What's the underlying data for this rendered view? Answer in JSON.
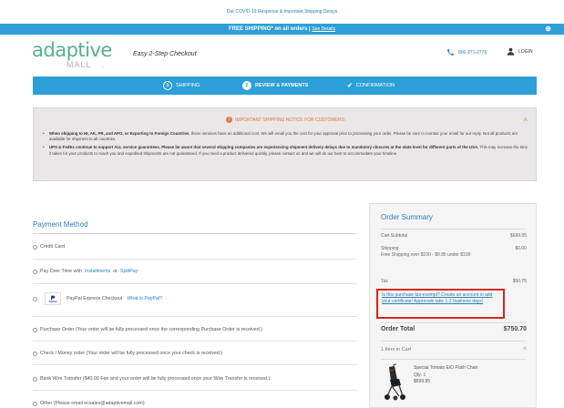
{
  "top_notice": "Our COVID-19 Response & Important Shipping Delays",
  "promo": {
    "text": "FREE SHIPPING* on all orders",
    "separator": "|",
    "details_link": "See Details",
    "expand_icon": "plus-circle-icon"
  },
  "header": {
    "logo_main": "adaptive",
    "logo_sub": "MALL",
    "logo_tm": "™",
    "tagline": "Easy 2-Step Checkout",
    "phone": "800-371-2778",
    "phone_icon": "phone-icon",
    "login": "LOGIN",
    "login_icon": "user-icon"
  },
  "steps": [
    {
      "number": "1",
      "label": "SHIPPING"
    },
    {
      "number": "2",
      "label": "REVIEW & PAYMENTS"
    },
    {
      "check": "✔",
      "label": "CONFIRMATION"
    }
  ],
  "notice": {
    "title": "IMPORTANT SHIPPING NOTICE FOR CUSTOMERS:",
    "bang": "!",
    "caret": "˄",
    "item1_bold": "When shipping to HI, AK, PR, and APO, or Exporting to Foreign Countries",
    "item1_text": ", these services have an additional cost. We will email you the cost for your approval prior to processing your order. Please be sure to monitor your email for our reply. Not all products are available for shipment to all countries.",
    "item2_bold": "UPS & FedEx continue to support ALL service guarantees. Please be aware that several shipping companies are experiencing shipment delivery delays due to mandatory closures at the state level for different parts of the USA.",
    "item2_text": " This may increase the time it takes for your products to reach you and expedited shipments are not guaranteed. If you need a product delivered quickly, please contact us and we will do our best to accommodate your timeline."
  },
  "payment": {
    "title": "Payment Method",
    "options": {
      "credit_card": "Credit Card",
      "pay_over_time_prefix": "Pay Over Time with",
      "installments": "Installments",
      "or": "or",
      "splitpay": "SplitPay",
      "paypal_logo": "PayPal",
      "paypal_label": "PayPal Express Checkout",
      "paypal_link": "What is PayPal?",
      "purchase_order": "Purchase Order (Your order will be fully processed once the corresponding Purchase Order is received.)",
      "check": "Check / Money order (Your order will be fully processed once your check is received.)",
      "bank_wire": "Bank Wire Transfer ($40.00 Fee and your order will be fully processed once your Wire Transfer is received.)",
      "other": "Other (Please email ecsales@adaptivemall.com)"
    }
  },
  "summary": {
    "title": "Order Summary",
    "subtotal_label": "Cart Subtotal",
    "subtotal_value": "$699.95",
    "shipping_label": "Shipping",
    "shipping_value": "$0.00",
    "shipping_note": "Free Shipping over $100 - $9.95 under $100",
    "tax_label": "Tax",
    "tax_value": "$50.75",
    "tax_exempt_link": "Is this purchase tax-exempt? Create an account to add your certificate! Approvals take 1-2 business days!",
    "total_label": "Order Total",
    "total_value": "$750.70",
    "items_label": "1 Item in Cart",
    "items_caret": "˄",
    "product": {
      "name": "Special Tomato EIO Push Chair",
      "qty": "Qty: 1",
      "price": "$699.95"
    }
  },
  "colors": {
    "brand_blue": "#2d9fd8",
    "link_blue": "#2a7fb8",
    "logo_green": "#5ab08c",
    "notice_orange": "#e07a40",
    "highlight_red": "#d6281e"
  }
}
